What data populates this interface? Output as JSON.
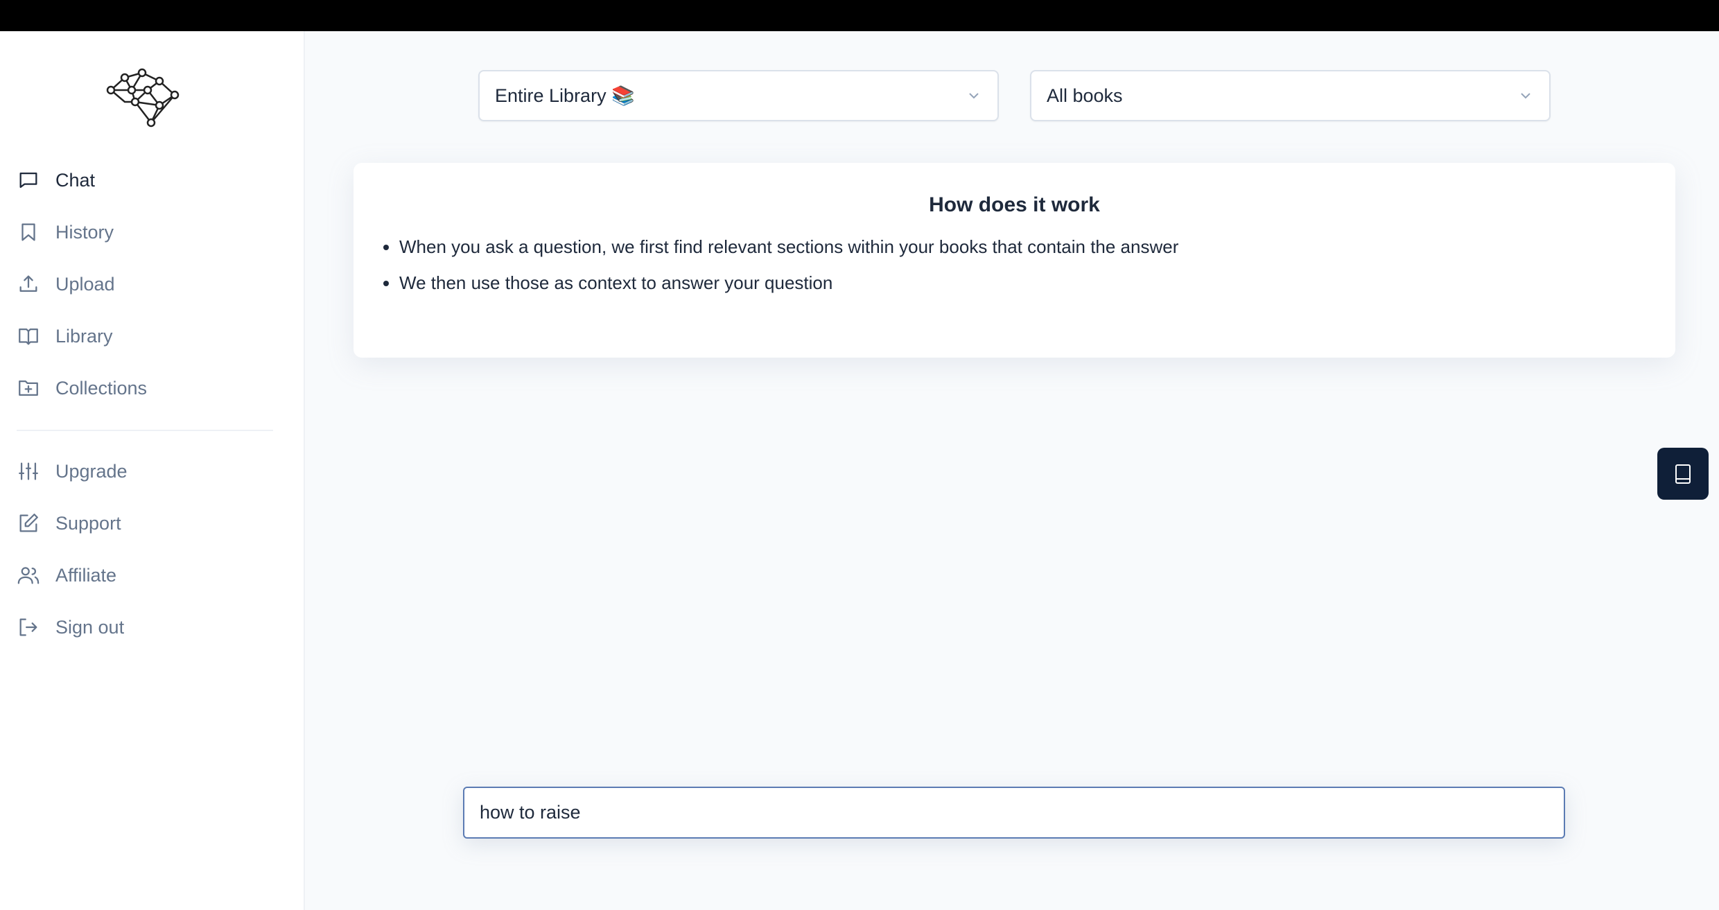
{
  "sidebar": {
    "items": [
      {
        "label": "Chat",
        "icon": "chat-bubble-icon",
        "active": true
      },
      {
        "label": "History",
        "icon": "bookmark-icon"
      },
      {
        "label": "Upload",
        "icon": "upload-icon"
      },
      {
        "label": "Library",
        "icon": "book-open-icon"
      },
      {
        "label": "Collections",
        "icon": "folder-plus-icon"
      },
      {
        "label": "Upgrade",
        "icon": "sliders-icon"
      },
      {
        "label": "Support",
        "icon": "edit-icon"
      },
      {
        "label": "Affiliate",
        "icon": "users-icon"
      },
      {
        "label": "Sign out",
        "icon": "sign-out-icon"
      }
    ]
  },
  "filters": {
    "scope": "Entire Library 📚",
    "books": "All books"
  },
  "info": {
    "title": "How does it work",
    "bullets": [
      "When you ask a question, we first find relevant sections within your books that contain the answer",
      "We then use those as context to answer your question"
    ]
  },
  "chat": {
    "input_value": "how to raise"
  },
  "colors": {
    "side_button": "#0f1f38",
    "input_border": "#5b7bb3"
  }
}
